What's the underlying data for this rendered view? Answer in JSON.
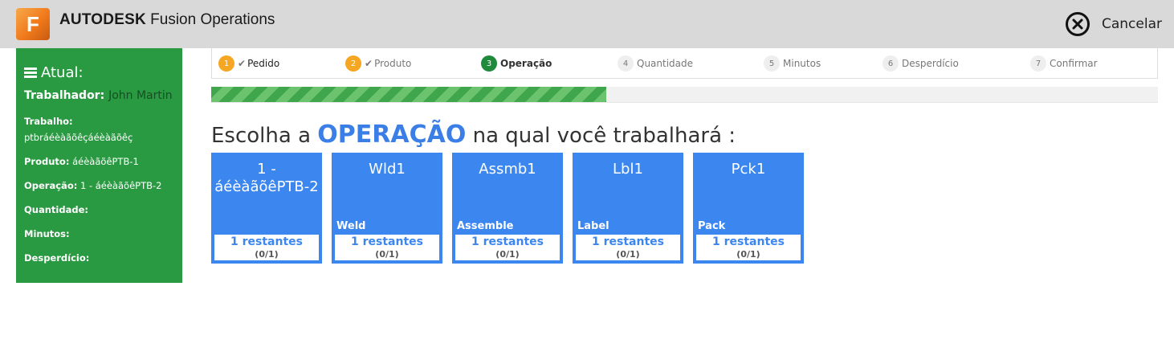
{
  "header": {
    "logo_letter": "F",
    "brand_bold": "AUTODESK",
    "brand_product": "Fusion Operations",
    "cancel_label": "Cancelar",
    "cancel_icon": "close-circle-icon"
  },
  "sidebar": {
    "title": "Atual:",
    "title_icon": "hamburger-icon",
    "worker_label": "Trabalhador:",
    "worker_value": "John Martin",
    "job_label": "Trabalho:",
    "job_value": "ptbráéèàãõêçáéèàãõêç",
    "product_label": "Produto:",
    "product_value": "áéèàãõêPTB-1",
    "operation_label": "Operação:",
    "operation_value": "1 - áéèàãõêPTB-2",
    "quantity_label": "Quantidade:",
    "minutes_label": "Minutos:",
    "waste_label": "Desperdício:"
  },
  "steps": [
    {
      "num": "1",
      "label": "Pedido",
      "state": "done"
    },
    {
      "num": "2",
      "label": "Produto",
      "state": "done"
    },
    {
      "num": "3",
      "label": "Operação",
      "state": "active"
    },
    {
      "num": "4",
      "label": "Quantidade",
      "state": "pending"
    },
    {
      "num": "5",
      "label": "Minutos",
      "state": "pending"
    },
    {
      "num": "6",
      "label": "Desperdício",
      "state": "pending"
    },
    {
      "num": "7",
      "label": "Confirmar",
      "state": "pending"
    }
  ],
  "progress": {
    "fraction": 0.417
  },
  "heading": {
    "prefix": "Escolha a",
    "emphasis": "OPERAÇÃO",
    "suffix": "na qual você trabalhará :"
  },
  "operations": [
    {
      "code": "1 - áéèàãõêPTB-2",
      "description": "",
      "remaining": "1 restantes",
      "ratio": "(0/1)"
    },
    {
      "code": "Wld1",
      "description": "Weld",
      "remaining": "1 restantes",
      "ratio": "(0/1)"
    },
    {
      "code": "Assmb1",
      "description": "Assemble",
      "remaining": "1 restantes",
      "ratio": "(0/1)"
    },
    {
      "code": "Lbl1",
      "description": "Label",
      "remaining": "1 restantes",
      "ratio": "(0/1)"
    },
    {
      "code": "Pck1",
      "description": "Pack",
      "remaining": "1 restantes",
      "ratio": "(0/1)"
    }
  ],
  "colors": {
    "sidebar_bg": "#2a9a42",
    "tile_bg": "#3b86ef",
    "step_done": "#f5a623",
    "step_active": "#1f8a3b",
    "accent_blue": "#3a7ee6"
  }
}
